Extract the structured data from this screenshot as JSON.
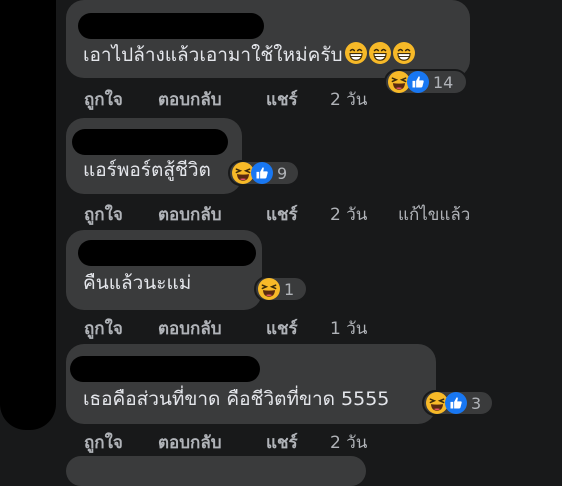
{
  "comments": [
    {
      "text": "เอาไปล้างแล้วเอามาใช้ใหม่ครับ",
      "inline_emojis": [
        "grin-face",
        "grin-face",
        "grin-face"
      ],
      "reactions": [
        "laugh",
        "like"
      ],
      "reaction_count": "14",
      "actions": {
        "like": "ถูกใจ",
        "reply": "ตอบกลับ",
        "share": "แชร์",
        "time": "2 วัน"
      }
    },
    {
      "text": "แอร์พอร์ตสู้ชีวิต",
      "reactions": [
        "laugh",
        "like"
      ],
      "reaction_count": "9",
      "actions": {
        "like": "ถูกใจ",
        "reply": "ตอบกลับ",
        "share": "แชร์",
        "time": "2 วัน",
        "edited": "แก้ไขแล้ว"
      }
    },
    {
      "text": "คืนแล้วนะแม่",
      "reactions": [
        "laugh"
      ],
      "reaction_count": "1",
      "actions": {
        "like": "ถูกใจ",
        "reply": "ตอบกลับ",
        "share": "แชร์",
        "time": "1 วัน"
      }
    },
    {
      "text": "เธอคือส่วนที่ขาด คือชีวิตที่ขาด 5555",
      "reactions": [
        "laugh",
        "like"
      ],
      "reaction_count": "3",
      "actions": {
        "like": "ถูกใจ",
        "reply": "ตอบกลับ",
        "share": "แชร์",
        "time": "2 วัน"
      }
    }
  ],
  "colors": {
    "background": "#18191a",
    "bubble": "#3a3b3c",
    "text": "#e4e6eb",
    "muted": "#b0b3b8",
    "like_blue": "#1877f2",
    "emoji_yellow": "#f7b928"
  }
}
